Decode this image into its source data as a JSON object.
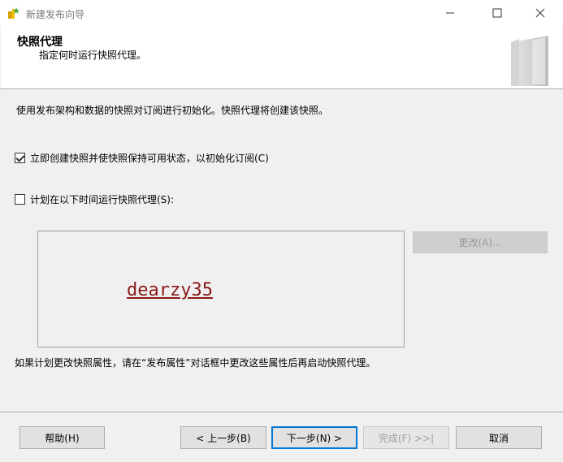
{
  "window": {
    "title": "新建发布向导",
    "icon": "wizard-app-icon"
  },
  "header": {
    "title": "快照代理",
    "subtitle": "指定何时运行快照代理。"
  },
  "body": {
    "description": "使用发布架构和数据的快照对订阅进行初始化。快照代理将创建该快照。",
    "options": [
      {
        "label": "立即创建快照并使快照保持可用状态，以初始化订阅(C)",
        "checked": true
      },
      {
        "label": "计划在以下时间运行快照代理(S):",
        "checked": false
      }
    ],
    "change_button": "更改(A)...",
    "watermark": "dearzy35",
    "note": "如果计划更改快照属性，请在“发布属性”对话框中更改这些属性后再启动快照代理。"
  },
  "footer": {
    "help": "帮助(H)",
    "back": "< 上一步(B)",
    "next": "下一步(N) >",
    "finish": "完成(F) >>|",
    "cancel": "取消"
  }
}
